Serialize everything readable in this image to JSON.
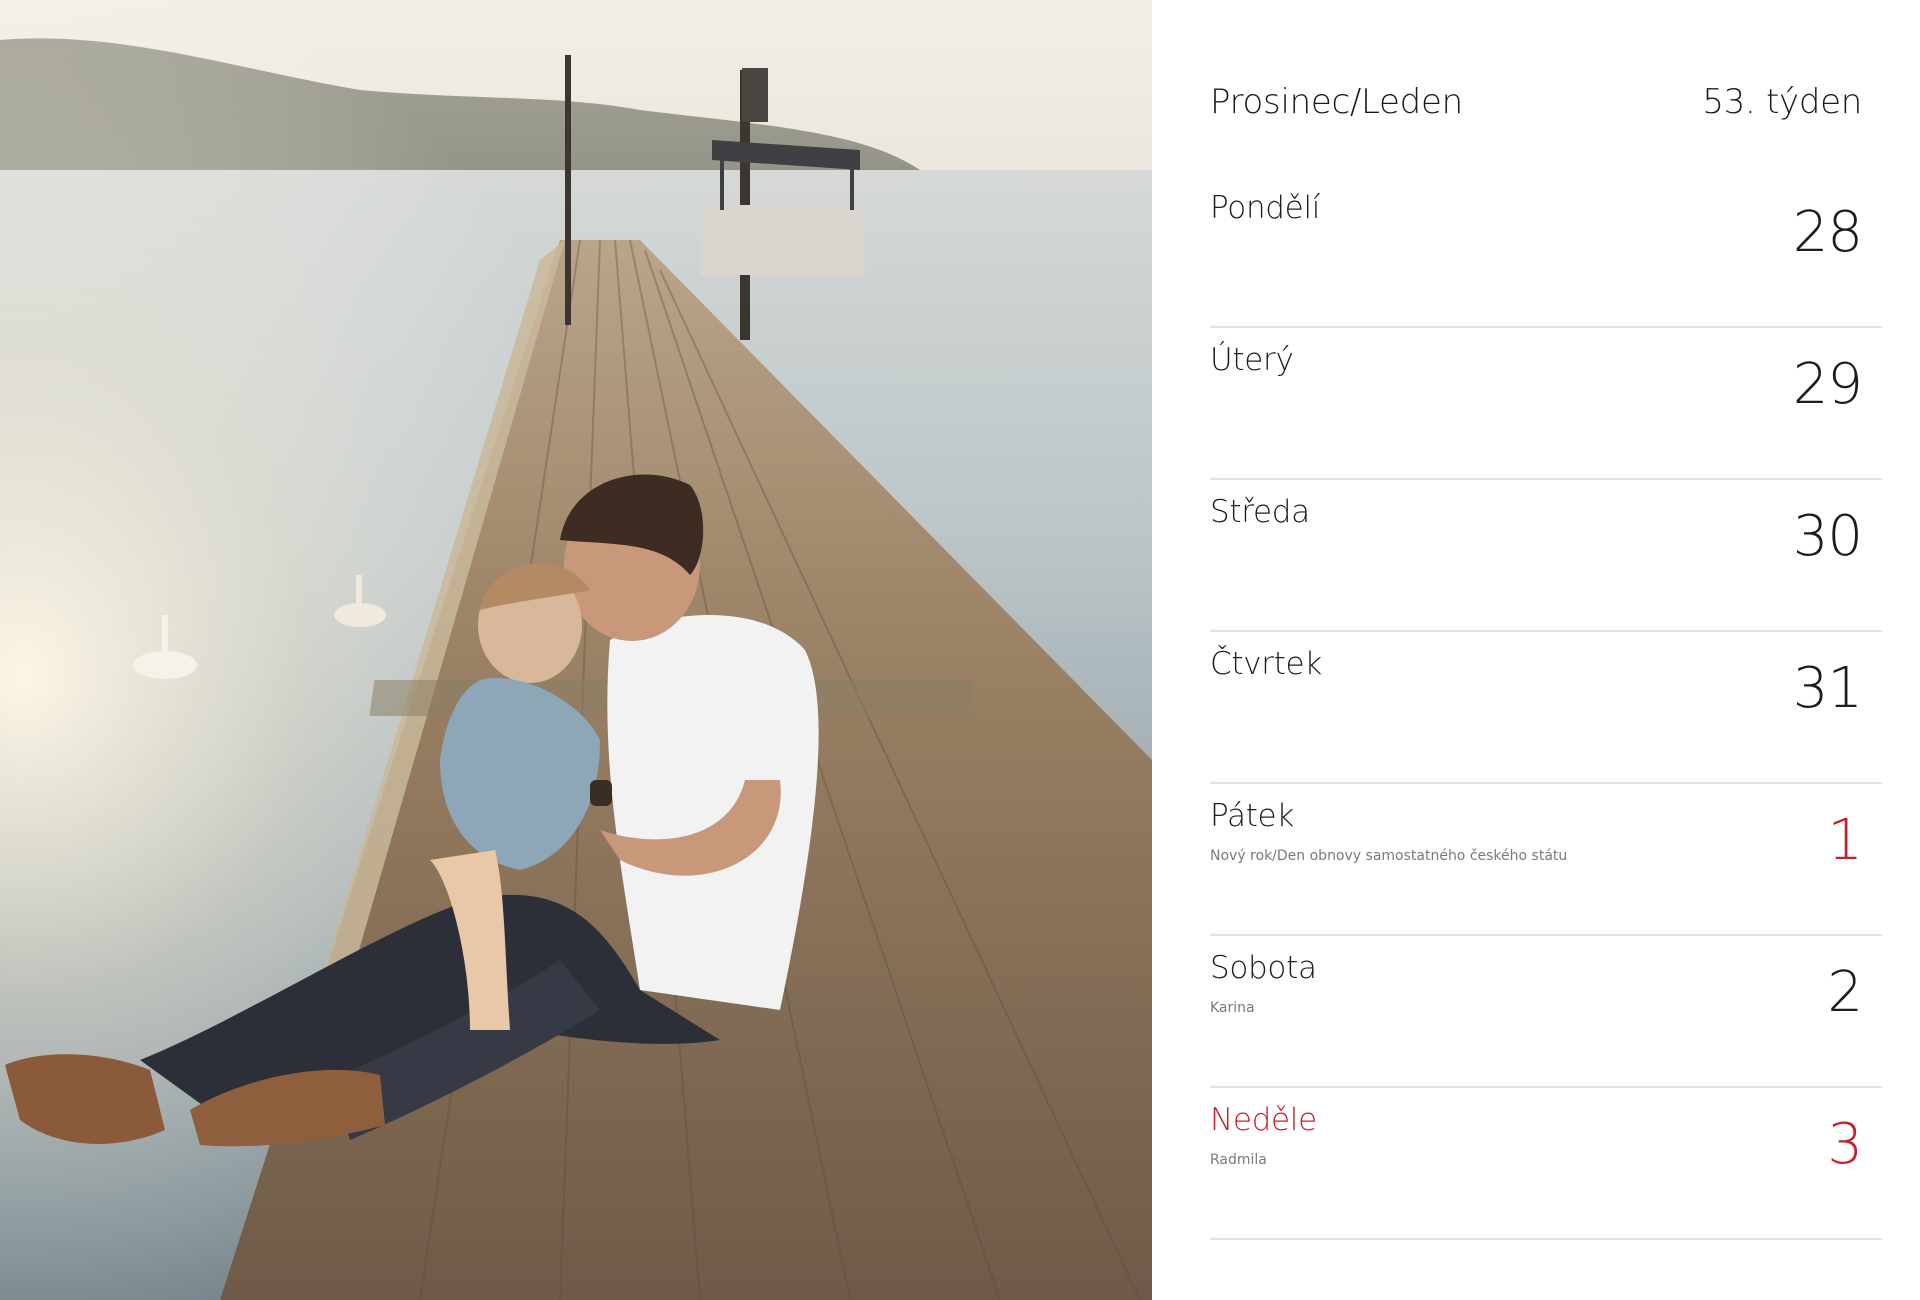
{
  "header": {
    "month": "Prosinec/Leden",
    "week": "53. týden"
  },
  "days": [
    {
      "name": "Pondělí",
      "number": "28",
      "note": "",
      "highlight_name": false,
      "highlight_number": false
    },
    {
      "name": "Úterý",
      "number": "29",
      "note": "",
      "highlight_name": false,
      "highlight_number": false
    },
    {
      "name": "Středa",
      "number": "30",
      "note": "",
      "highlight_name": false,
      "highlight_number": false
    },
    {
      "name": "Čtvrtek",
      "number": "31",
      "note": "",
      "highlight_name": false,
      "highlight_number": false
    },
    {
      "name": "Pátek",
      "number": "1",
      "note": "Nový rok/Den obnovy samostatného českého státu",
      "highlight_name": false,
      "highlight_number": true
    },
    {
      "name": "Sobota",
      "number": "2",
      "note": "Karina",
      "highlight_name": false,
      "highlight_number": false
    },
    {
      "name": "Neděle",
      "number": "3",
      "note": "Radmila",
      "highlight_name": true,
      "highlight_number": true
    }
  ],
  "colors": {
    "accent_red": "#c6212b",
    "text": "#1c1c1c",
    "note": "#7a7a7a",
    "divider": "#e3e3e3"
  },
  "photo": {
    "icon": "photo-father-daughter-pier"
  }
}
